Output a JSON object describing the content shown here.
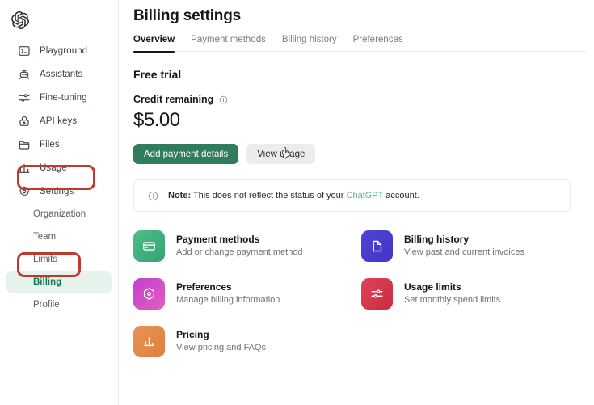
{
  "brand": {
    "logo_icon": "openai-logo"
  },
  "sidebar": {
    "items": [
      {
        "label": "Playground",
        "icon": "terminal-icon"
      },
      {
        "label": "Assistants",
        "icon": "robot-icon"
      },
      {
        "label": "Fine-tuning",
        "icon": "sliders-icon"
      },
      {
        "label": "API keys",
        "icon": "lock-icon"
      },
      {
        "label": "Files",
        "icon": "folder-icon"
      },
      {
        "label": "Usage",
        "icon": "bar-chart-icon"
      },
      {
        "label": "Settings",
        "icon": "gear-icon"
      }
    ],
    "sub_items": [
      {
        "label": "Organization",
        "active": false
      },
      {
        "label": "Team",
        "active": false
      },
      {
        "label": "Limits",
        "active": false
      },
      {
        "label": "Billing",
        "active": true
      },
      {
        "label": "Profile",
        "active": false
      }
    ],
    "active_color": "#127a52",
    "active_bg": "#e6f2ec"
  },
  "annotations": {
    "color": "#c0392b",
    "boxes": [
      {
        "target": "Settings"
      },
      {
        "target": "Billing"
      }
    ]
  },
  "header": {
    "title": "Billing settings"
  },
  "tabs": [
    {
      "label": "Overview",
      "active": true
    },
    {
      "label": "Payment methods",
      "active": false
    },
    {
      "label": "Billing history",
      "active": false
    },
    {
      "label": "Preferences",
      "active": false
    }
  ],
  "trial": {
    "section_title": "Free trial",
    "credit_label": "Credit remaining",
    "credit_info_icon": "info-icon",
    "amount": "$5.00",
    "primary_button": "Add payment details",
    "secondary_button": "View usage",
    "primary_color": "#2f7d5d"
  },
  "note": {
    "icon": "info-icon",
    "bold_prefix": "Note:",
    "text_before": " This does not reflect the status of your ",
    "link_text": "ChatGPT",
    "text_after": " account.",
    "link_color": "#5fb394"
  },
  "cards": [
    {
      "title": "Payment methods",
      "subtitle": "Add or change payment method",
      "icon": "credit-card-icon",
      "color_from": "#4dbd8a",
      "color_to": "#34a473"
    },
    {
      "title": "Billing history",
      "subtitle": "View past and current invoices",
      "icon": "document-icon",
      "color_from": "#5244d6",
      "color_to": "#4035c4"
    },
    {
      "title": "Preferences",
      "subtitle": "Manage billing information",
      "icon": "gear-icon",
      "color_from": "#c33fd6",
      "color_to": "#e05fb8"
    },
    {
      "title": "Usage limits",
      "subtitle": "Set monthly spend limits",
      "icon": "sliders-icon",
      "color_from": "#e0435a",
      "color_to": "#c92c3f"
    },
    {
      "title": "Pricing",
      "subtitle": "View pricing and FAQs",
      "icon": "bar-chart-icon",
      "color_from": "#e99356",
      "color_to": "#dd7f3e"
    }
  ],
  "cursor": {
    "icon": "pointer-cursor"
  }
}
